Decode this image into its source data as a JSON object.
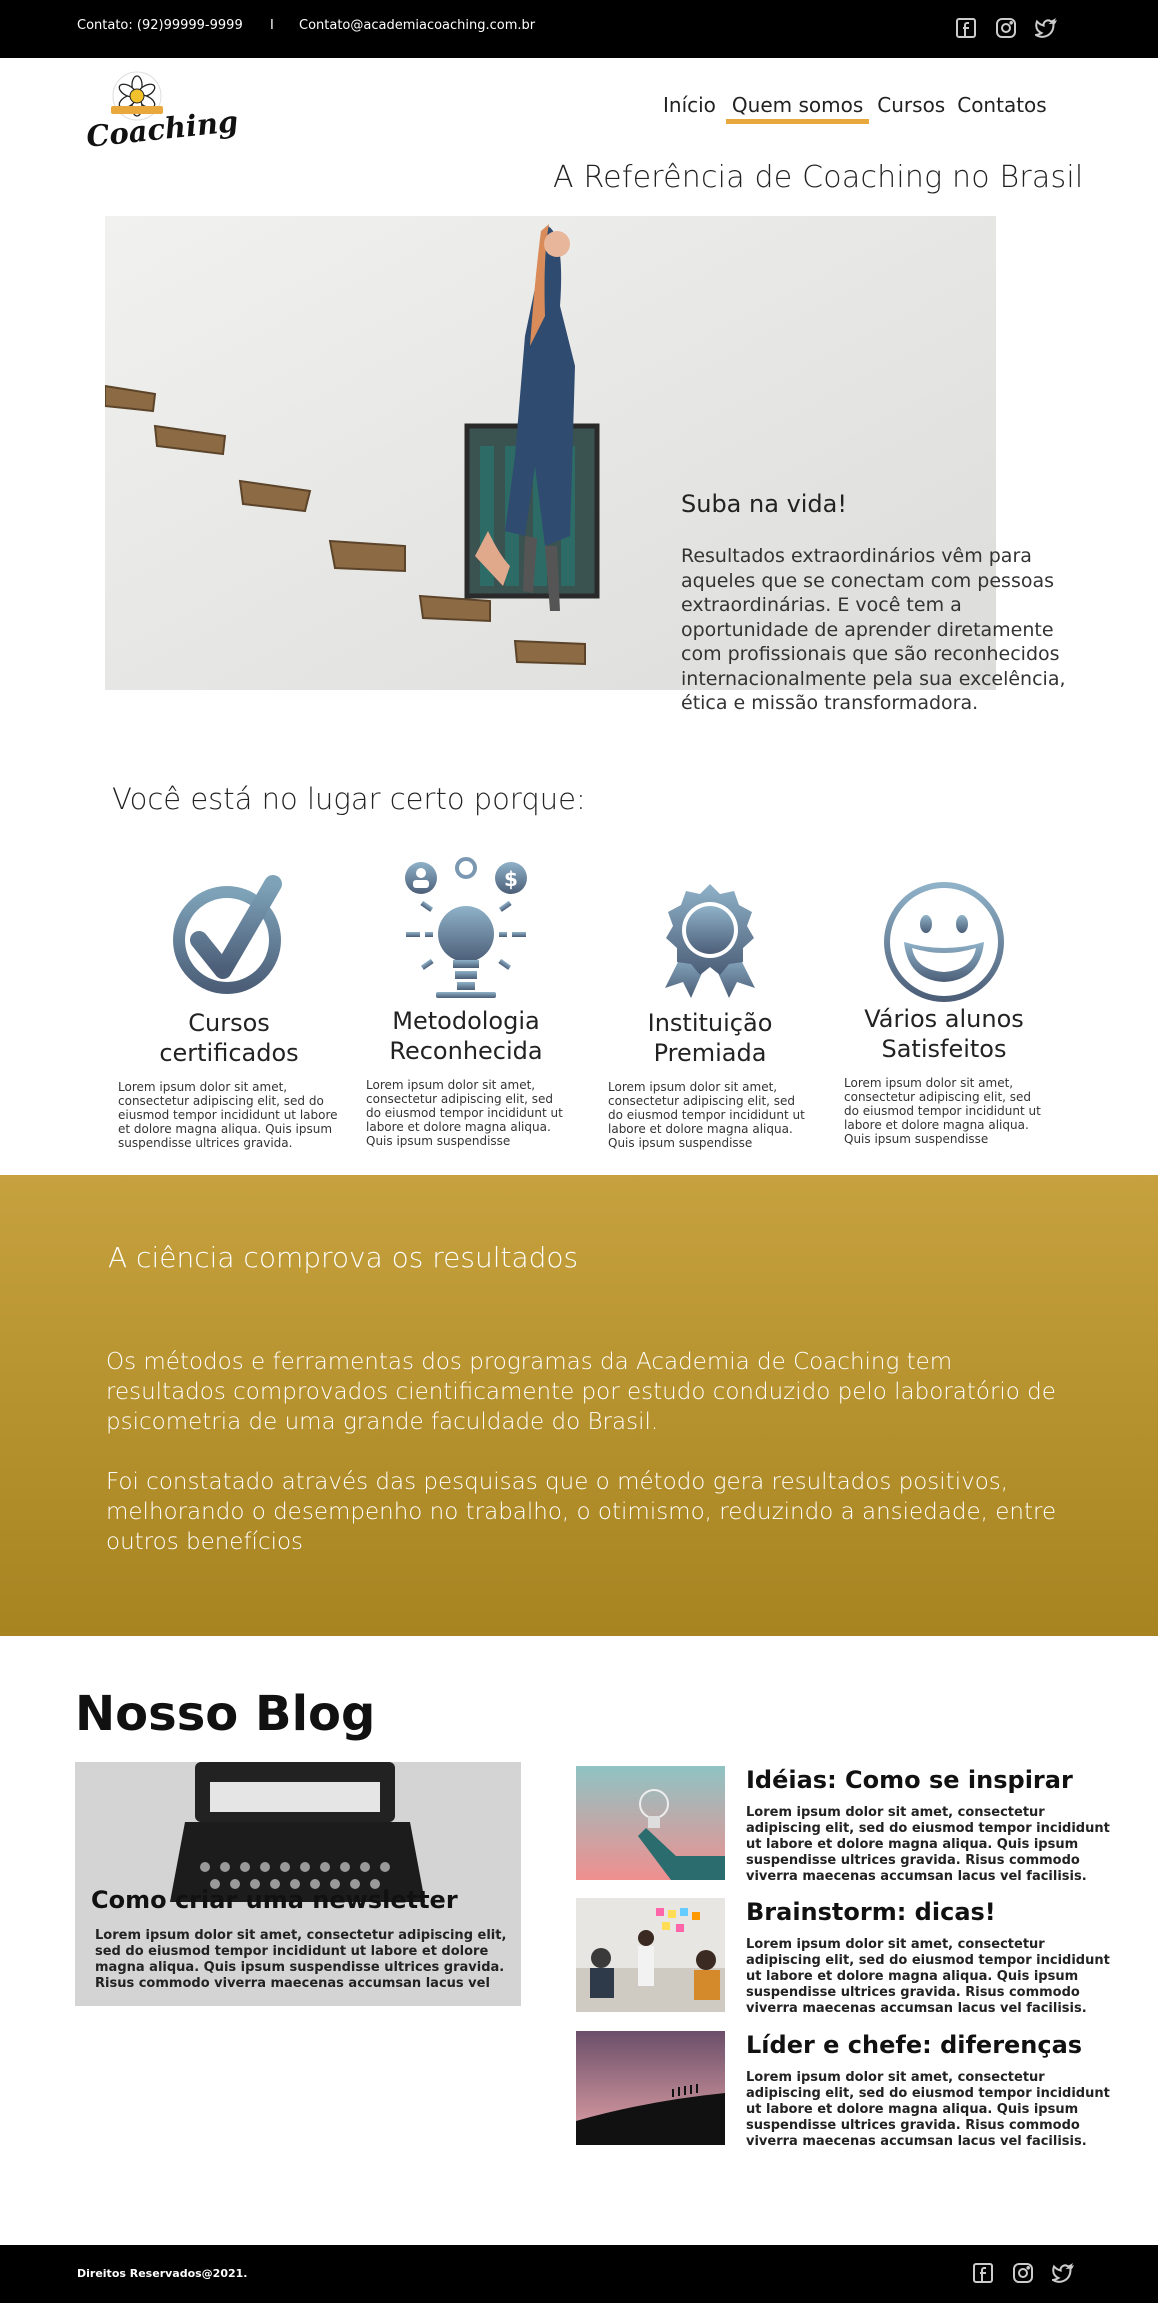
{
  "topbar": {
    "phone": "Contato: (92)99999-9999",
    "separator": "I",
    "email": "Contato@academiacoaching.com.br"
  },
  "logo": {
    "text": "Coaching",
    "icon": "flower-logo-icon"
  },
  "nav": {
    "items": [
      "Início",
      "Quem somos",
      "Cursos",
      "Contatos"
    ],
    "active": "Quem somos"
  },
  "hero": {
    "title": "A Referência de Coaching no Brasil",
    "subtitle": "Suba na vida!",
    "text": "Resultados extraordinários vêm para aqueles que se conectam com pessoas extraordinárias. E você tem a oportunidade de aprender diretamente com profissionais que são reconhecidos internacionalmente pela sua excelência, ética e missão transformadora."
  },
  "why": {
    "title": "Você está no lugar certo porque:",
    "features": [
      {
        "icon": "checkmark-icon",
        "title": "Cursos certificados",
        "text": "Lorem ipsum dolor sit amet, consectetur adipiscing elit, sed do eiusmod tempor incididunt ut labore et dolore magna aliqua. Quis ipsum suspendisse ultrices gravida."
      },
      {
        "icon": "lightbulb-icon",
        "title": "Metodologia Reconhecida",
        "text": "Lorem ipsum dolor sit amet, consectetur adipiscing elit, sed do eiusmod tempor incididunt ut labore et dolore magna aliqua. Quis ipsum suspendisse"
      },
      {
        "icon": "award-medal-icon",
        "title": "Instituição Premiada",
        "text": "Lorem ipsum dolor sit amet, consectetur adipiscing elit, sed do eiusmod tempor incididunt ut labore et dolore magna aliqua. Quis ipsum suspendisse"
      },
      {
        "icon": "smiley-icon",
        "title": "Vários alunos Satisfeitos",
        "text": "Lorem ipsum dolor sit amet, consectetur adipiscing elit, sed do eiusmod tempor incididunt ut labore et dolore magna aliqua. Quis ipsum suspendisse"
      }
    ]
  },
  "science": {
    "title": "A ciência comprova os resultados",
    "p1": "Os métodos e ferramentas dos programas  da Academia de Coaching tem resultados comprovados cientificamente por estudo conduzido pelo laboratório de psicometria de uma grande faculdade do Brasil.",
    "p2": "Foi constatado através das pesquisas que o método gera resultados positivos, melhorando o desempenho no trabalho, o otimismo, reduzindo a ansiedade, entre outros benefícios"
  },
  "blog": {
    "title": "Nosso Blog",
    "featured": {
      "title": "Como criar uma newsletter",
      "text": "Lorem ipsum dolor sit amet, consectetur adipiscing elit, sed do eiusmod tempor incididunt ut labore et dolore magna aliqua. Quis ipsum suspendisse ultrices gravida. Risus commodo viverra maecenas accumsan lacus vel"
    },
    "posts": [
      {
        "title": "Idéias: Como se inspirar",
        "text": "Lorem ipsum dolor sit amet, consectetur adipiscing elit, sed do eiusmod tempor incididunt ut labore et dolore magna aliqua. Quis ipsum suspendisse ultrices gravida. Risus commodo viverra maecenas accumsan lacus vel facilisis."
      },
      {
        "title": "Brainstorm: dicas!",
        "text": "Lorem ipsum dolor sit amet, consectetur adipiscing elit, sed do eiusmod tempor incididunt ut labore et dolore magna aliqua. Quis ipsum suspendisse ultrices gravida. Risus commodo viverra maecenas accumsan lacus vel facilisis."
      },
      {
        "title": "Líder e chefe: diferenças",
        "text": "Lorem ipsum dolor sit amet, consectetur adipiscing elit, sed do eiusmod tempor incididunt ut labore et dolore magna aliqua. Quis ipsum suspendisse ultrices gravida. Risus commodo viverra maecenas accumsan lacus vel facilisis."
      }
    ]
  },
  "footer": {
    "copyright": "Direitos Reservados@2021."
  },
  "social_icons": [
    "facebook-icon",
    "instagram-icon",
    "twitter-icon"
  ],
  "colors": {
    "accent": "#e8a83c",
    "gold_top": "#c6a13e",
    "gold_bottom": "#a78420",
    "icon_blue": "#5a7a96"
  }
}
